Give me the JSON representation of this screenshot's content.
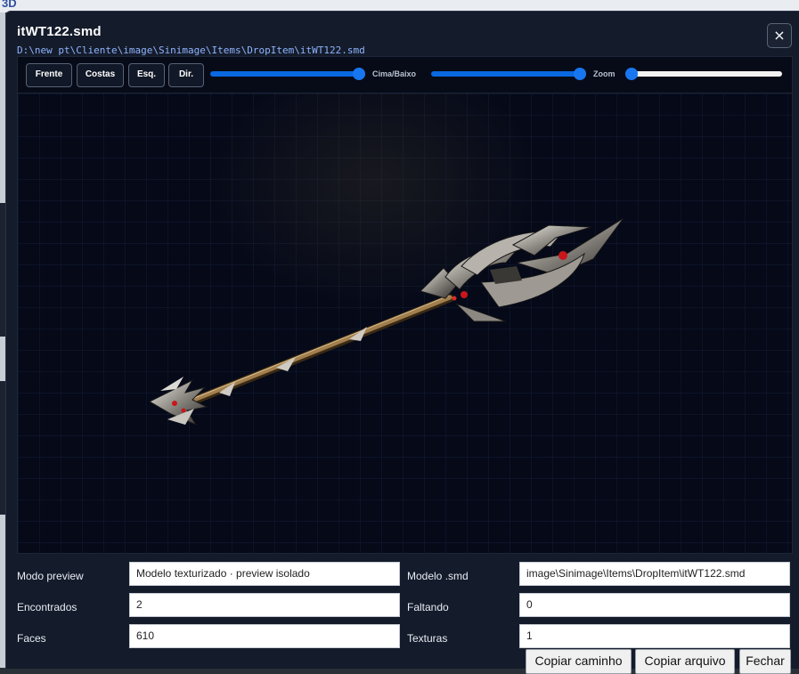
{
  "background": {
    "top_text": "3D"
  },
  "dialog": {
    "title": "itWT122.smd",
    "path": "D:\\new pt\\Cliente\\image\\Sinimage\\Items\\DropItem\\itWT122.smd",
    "close_icon": "×"
  },
  "toolbar": {
    "front": "Frente",
    "back": "Costas",
    "left": "Esq.",
    "right": "Dir.",
    "rotate_slider_value": 1.0,
    "updown_label": "Cima/Baixo",
    "updown_slider_value": 1.0,
    "zoom_label": "Zoom",
    "zoom_slider_value": 0.0
  },
  "info": {
    "modo_label": "Modo preview",
    "modo_value": "Modelo texturizado · preview isolado",
    "modelo_label": "Modelo .smd",
    "modelo_value": "image\\Sinimage\\Items\\DropItem\\itWT122.smd",
    "encontrados_label": "Encontrados",
    "encontrados_value": "2",
    "faltando_label": "Faltando",
    "faltando_value": "0",
    "faces_label": "Faces",
    "faces_value": "610",
    "texturas_label": "Texturas",
    "texturas_value": "1"
  },
  "actions": {
    "copy_path": "Copiar caminho",
    "copy_file": "Copiar arquivo",
    "close": "Fechar"
  },
  "colors": {
    "accent": "#1776f0",
    "dialog_bg": "#141b2a",
    "viewer_bg": "#060a1a",
    "path_text": "#8fb4ff"
  }
}
